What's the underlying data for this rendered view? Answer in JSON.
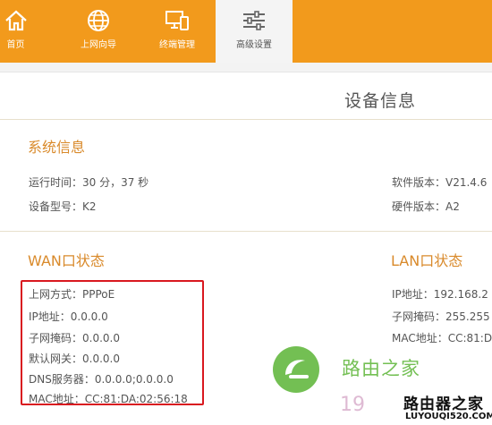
{
  "nav": {
    "items": [
      {
        "label": "首页",
        "icon": "home-icon"
      },
      {
        "label": "上网向导",
        "icon": "globe-icon"
      },
      {
        "label": "终端管理",
        "icon": "devices-icon"
      },
      {
        "label": "高级设置",
        "icon": "sliders-icon"
      }
    ],
    "active_index": 3
  },
  "page": {
    "title": "设备信息"
  },
  "system": {
    "title": "系统信息",
    "uptime": "运行时间：30 分，37 秒",
    "model": "设备型号：K2",
    "software": "软件版本：V21.4.6",
    "hardware": "硬件版本：A2"
  },
  "wan": {
    "title": "WAN口状态",
    "method": "上网方式：PPPoE",
    "ip": "IP地址：0.0.0.0",
    "mask": "子网掩码：0.0.0.0",
    "gateway": "默认网关：0.0.0.0",
    "dns": "DNS服务器：0.0.0.0;0.0.0.0",
    "mac": "MAC地址：CC:81:DA:02:56:18"
  },
  "lan": {
    "title": "LAN口状态",
    "ip": "IP地址：192.168.2",
    "mask": "子网掩码：255.255",
    "mac": "MAC地址：CC:81:D"
  },
  "watermark": {
    "brand": "路由之家",
    "number": "19",
    "badge_title": "路由器之家",
    "badge_url": "LUYOUQI520.COM"
  },
  "colors": {
    "accent": "#f29a1c",
    "section_title": "#d98a2b",
    "highlight_box": "#d9181f",
    "watermark_green": "#5bb536"
  }
}
